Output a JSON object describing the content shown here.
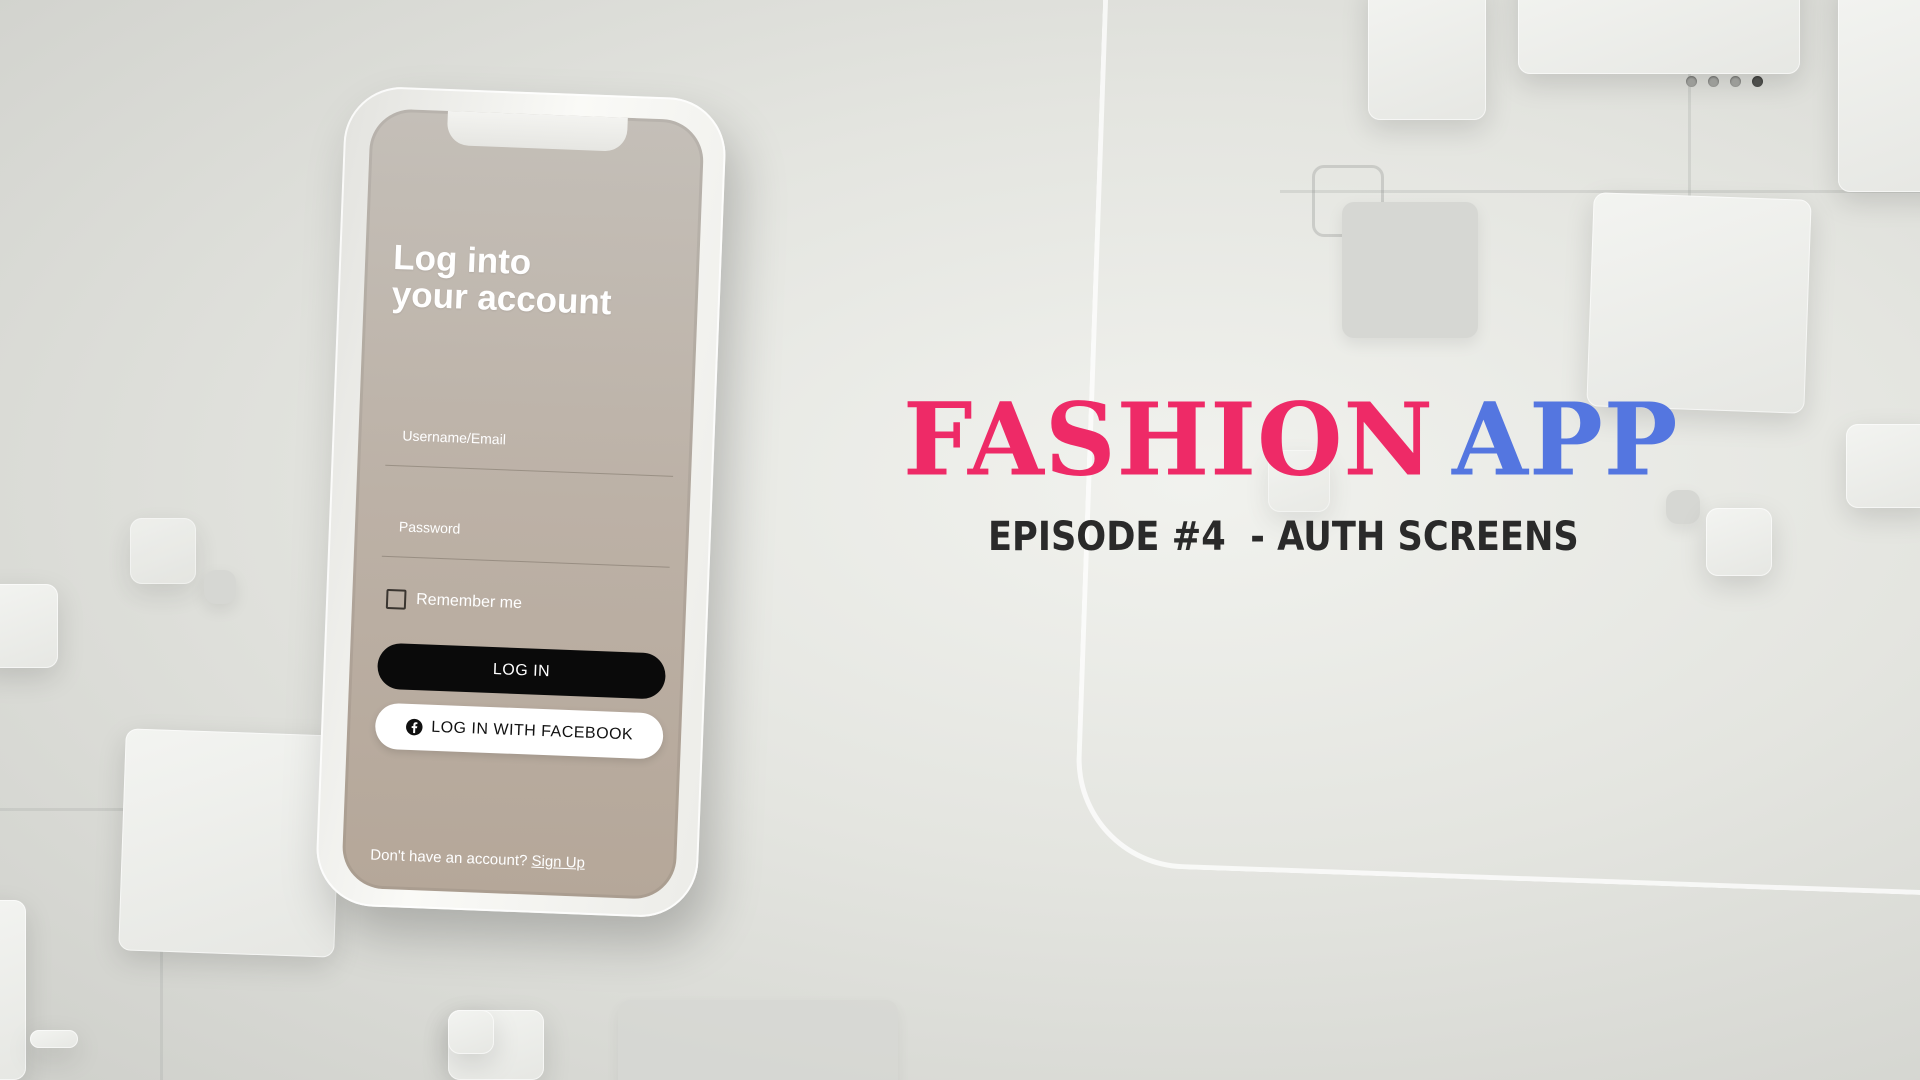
{
  "slide_indicator": {
    "count": 4,
    "active_index": 3
  },
  "phone": {
    "title_line1": "Log into",
    "title_line2": "your account",
    "username_label": "Username/Email",
    "password_label": "Password",
    "remember_label": "Remember me",
    "login_button": "LOG IN",
    "facebook_button": "LOG IN WITH FACEBOOK",
    "facebook_icon": "facebook-icon",
    "signup_prompt": "Don't have an account?",
    "signup_link": "Sign Up"
  },
  "headline": {
    "word1": "FASHION",
    "word2": "APP",
    "subtitle": "EPISODE #4  - AUTH SCREENS"
  },
  "colors": {
    "headline_pink": "#ee2a67",
    "headline_blue": "#5476e0",
    "login_button_bg": "#0a0a0a",
    "screen_bg": "#bcb1a6"
  }
}
